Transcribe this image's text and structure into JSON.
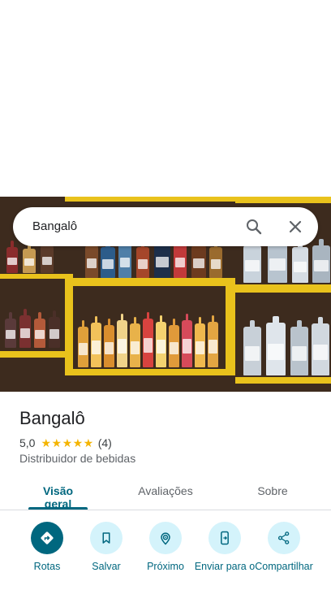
{
  "search": {
    "query": "Bangalô"
  },
  "place": {
    "name": "Bangalô",
    "rating": "5,0",
    "stars": "★★★★★",
    "review_count": "(4)",
    "category": "Distribuidor de bebidas"
  },
  "tabs": [
    {
      "label": "Visão geral",
      "active": true
    },
    {
      "label": "Avaliações",
      "active": false
    },
    {
      "label": "Sobre",
      "active": false
    }
  ],
  "actions": [
    {
      "label": "Rotas",
      "icon": "directions-icon"
    },
    {
      "label": "Salvar",
      "icon": "bookmark-icon"
    },
    {
      "label": "Próximo",
      "icon": "nearby-icon"
    },
    {
      "label": "Enviar para o",
      "icon": "send-to-phone-icon"
    },
    {
      "label": "Compartilhar",
      "icon": "share-icon"
    }
  ],
  "colors": {
    "accent": "#00677f",
    "action_bg": "#d4f3fb",
    "star": "#f4b400",
    "shelf": "#e9c21c"
  }
}
